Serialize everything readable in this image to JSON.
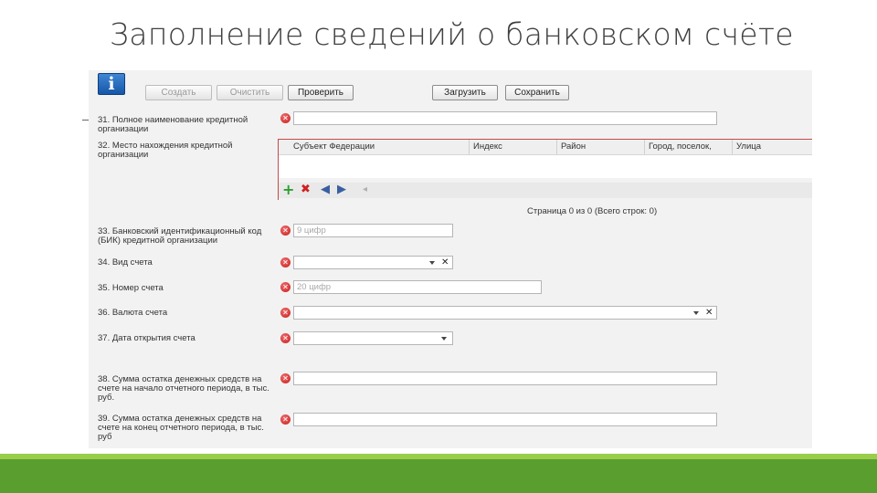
{
  "slide": {
    "title": "Заполнение сведений о банковском счёте"
  },
  "toolbar": {
    "info_icon": "info-icon",
    "create": "Создать",
    "clear": "Очистить",
    "check": "Проверить",
    "load": "Загрузить",
    "save": "Сохранить"
  },
  "fields": {
    "f31": {
      "label": "31. Полное наименование кредитной организации",
      "value": ""
    },
    "f32": {
      "label": "32. Место нахождения кредитной организации"
    },
    "f33": {
      "label": "33. Банковский идентификационный код (БИК) кредитной организации",
      "placeholder": "9 цифр"
    },
    "f34": {
      "label": "34. Вид счета",
      "clear": "✕"
    },
    "f35": {
      "label": "35. Номер счета",
      "placeholder": "20 цифр"
    },
    "f36": {
      "label": "36. Валюта счета",
      "clear": "✕"
    },
    "f37": {
      "label": "37. Дата открытия счета"
    },
    "f38": {
      "label": "38. Сумма остатка денежных средств на счете на начало отчетного периода, в тыс. руб."
    },
    "f39": {
      "label": "39. Сумма остатка денежных средств на счете на конец отчетного периода, в тыс. руб"
    }
  },
  "address_grid": {
    "columns": [
      "Субъект Федерации",
      "Индекс",
      "Район",
      "Город, поселок,",
      "Улица"
    ],
    "tools": {
      "add": "+",
      "delete": "✖",
      "left": "◀",
      "right": "▶",
      "scroll": "◂"
    },
    "pager": "Страница 0 из 0 (Всего строк: 0)"
  },
  "colors": {
    "error": "#c81818",
    "footer_light": "#9acd4a",
    "footer_dark": "#5a9e30"
  }
}
